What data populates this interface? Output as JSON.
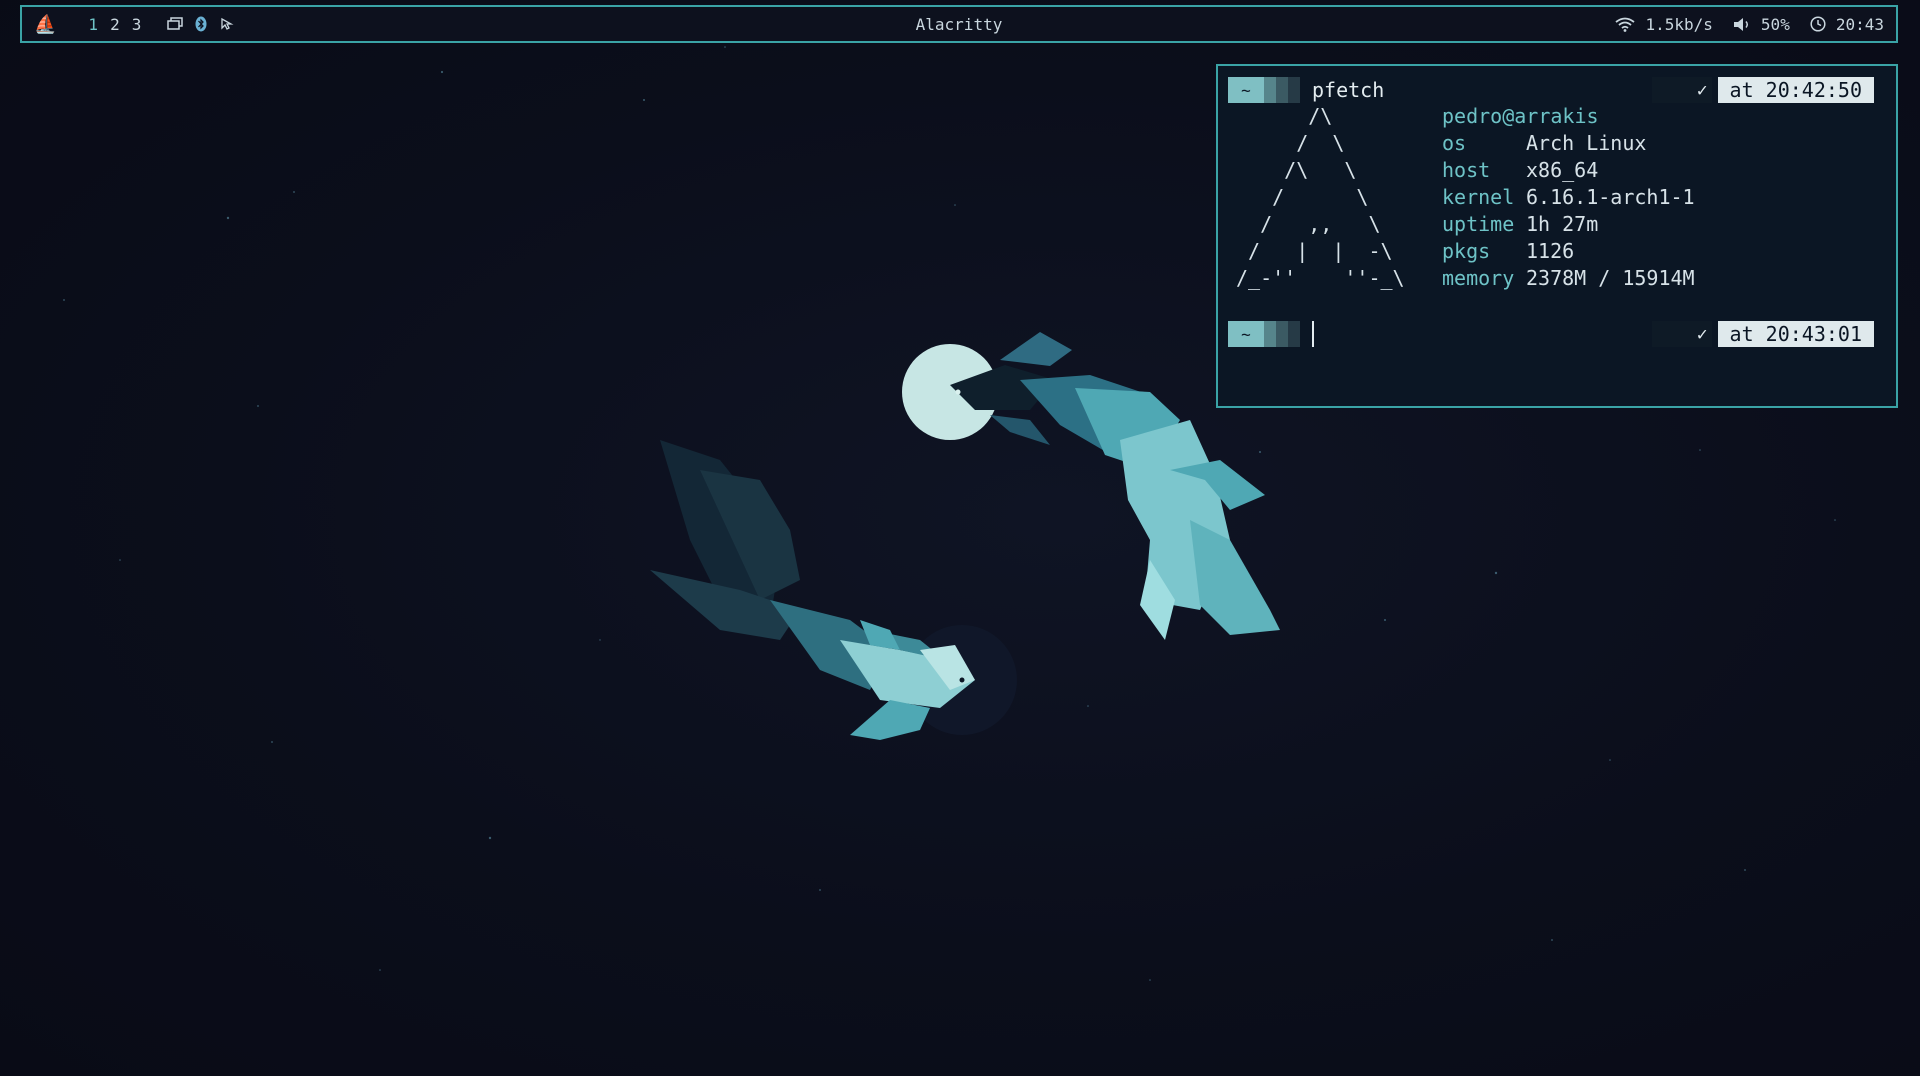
{
  "topbar": {
    "title": "Alacritty",
    "workspaces": [
      "1",
      "2",
      "3"
    ],
    "active_workspace": "1",
    "tray_icons": [
      "window-switcher-icon",
      "bluetooth-icon",
      "pointer-icon"
    ],
    "network_speed": "1.5kb/s",
    "volume": "50%",
    "clock": "20:43",
    "launcher_icon": "sailboat-icon"
  },
  "terminal": {
    "prompt_symbol": "~",
    "first_command": "pfetch",
    "first_status_symbol": "✓",
    "first_time": "at 20:42:50",
    "second_status_symbol": "✓",
    "second_time": "at 20:43:01",
    "ascii_logo": "      /\\\n     /  \\\n    /\\   \\\n   /      \\\n  /   ,,   \\\n /   |  |  -\\\n/_-''    ''-_\\",
    "user_host": "pedro@arrakis",
    "info": [
      {
        "key": "os",
        "value": "Arch Linux"
      },
      {
        "key": "host",
        "value": "x86_64"
      },
      {
        "key": "kernel",
        "value": "6.16.1-arch1-1"
      },
      {
        "key": "uptime",
        "value": "1h 27m"
      },
      {
        "key": "pkgs",
        "value": "1126"
      },
      {
        "key": "memory",
        "value": "2378M / 15914M"
      }
    ]
  },
  "colors": {
    "accent": "#3aa3a6",
    "accent_light": "#6ec3c7",
    "background": "#0b0e1b",
    "fish_light": "#9fdde0",
    "fish_mid": "#4fa8b4",
    "fish_dark": "#1c3a4a"
  }
}
